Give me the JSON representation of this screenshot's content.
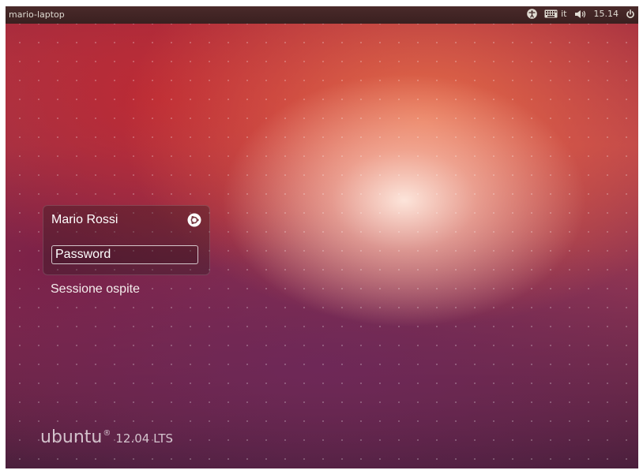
{
  "topbar": {
    "hostname": "mario-laptop",
    "icons": [
      "accessibility-icon",
      "keyboard-icon",
      "speaker-icon",
      "power-icon"
    ],
    "keyboard_layout": "it",
    "clock": "15.14"
  },
  "login": {
    "user_name": "Mario Rossi",
    "session_icon": "ubuntu-session-icon",
    "password_placeholder": "Password",
    "password_value": ""
  },
  "guest_session_label": "Sessione ospite",
  "branding": {
    "logo_text": "ubuntu",
    "registered_mark": "®",
    "version": "12.04 LTS"
  },
  "colors": {
    "topbar": "#3a2020",
    "text": "#ffffff"
  }
}
